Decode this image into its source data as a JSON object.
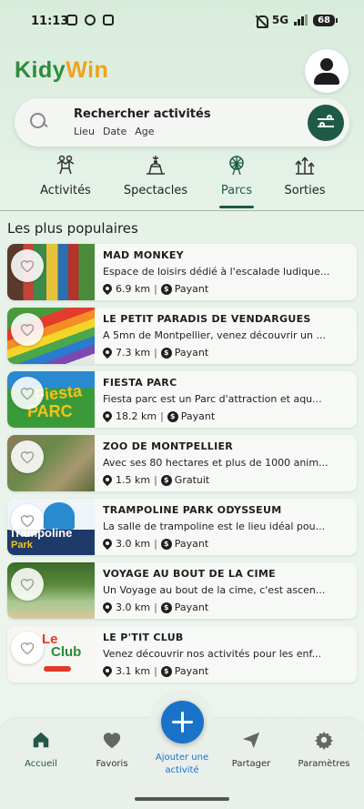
{
  "status_bar": {
    "time": "11:13",
    "network": "5G",
    "battery": "68"
  },
  "app": {
    "logo_part1": "Kidy",
    "logo_part2": "Win"
  },
  "search": {
    "title": "Rechercher activités",
    "tags": [
      "Lieu",
      "Date",
      "Age"
    ]
  },
  "tabs": [
    {
      "label": "Activités",
      "icon": "kids-icon"
    },
    {
      "label": "Spectacles",
      "icon": "spectacle-icon"
    },
    {
      "label": "Parcs",
      "icon": "ferris-wheel-icon",
      "active": true
    },
    {
      "label": "Sorties",
      "icon": "outing-icon"
    }
  ],
  "section_title": "Les plus populaires",
  "items": [
    {
      "title": "MAD MONKEY",
      "description": "Espace de loisirs dédié à l'escalade ludique...",
      "distance": "6.9 km",
      "price": "Payant"
    },
    {
      "title": "LE PETIT PARADIS DE VENDARGUES",
      "description": "A 5mn de Montpellier, venez découvrir un ...",
      "distance": "7.3 km",
      "price": "Payant"
    },
    {
      "title": "FIESTA PARC",
      "description": "Fiesta parc est un Parc d'attraction et aqu...",
      "distance": "18.2 km",
      "price": "Payant"
    },
    {
      "title": "ZOO DE MONTPELLIER",
      "description": "Avec ses 80 hectares et plus de 1000 anim...",
      "distance": "1.5 km",
      "price": "Gratuit"
    },
    {
      "title": "TRAMPOLINE PARK ODYSSEUM",
      "description": "La salle de trampoline est le lieu idéal pou...",
      "distance": "3.0 km",
      "price": "Payant"
    },
    {
      "title": "VOYAGE AU BOUT DE LA CIME",
      "description": "Un Voyage au bout de la cime, c'est ascen...",
      "distance": "3.0 km",
      "price": "Payant"
    },
    {
      "title": "LE P'TIT CLUB",
      "description": "Venez découvrir nos activités pour les enf...",
      "distance": "3.1 km",
      "price": "Payant"
    }
  ],
  "thumb_texts": [
    "Fiesta",
    "PARC",
    "Trampoline",
    "Park",
    "Le",
    "Club"
  ],
  "nav": {
    "home": "Accueil",
    "favorites": "Favoris",
    "add": "Ajouter une activité",
    "share": "Partager",
    "settings": "Paramètres"
  },
  "colors": {
    "primary": "#1f5a47",
    "accent_blue": "#1a73c9",
    "logo_green": "#2e8b3e",
    "logo_orange": "#f0a21a"
  }
}
